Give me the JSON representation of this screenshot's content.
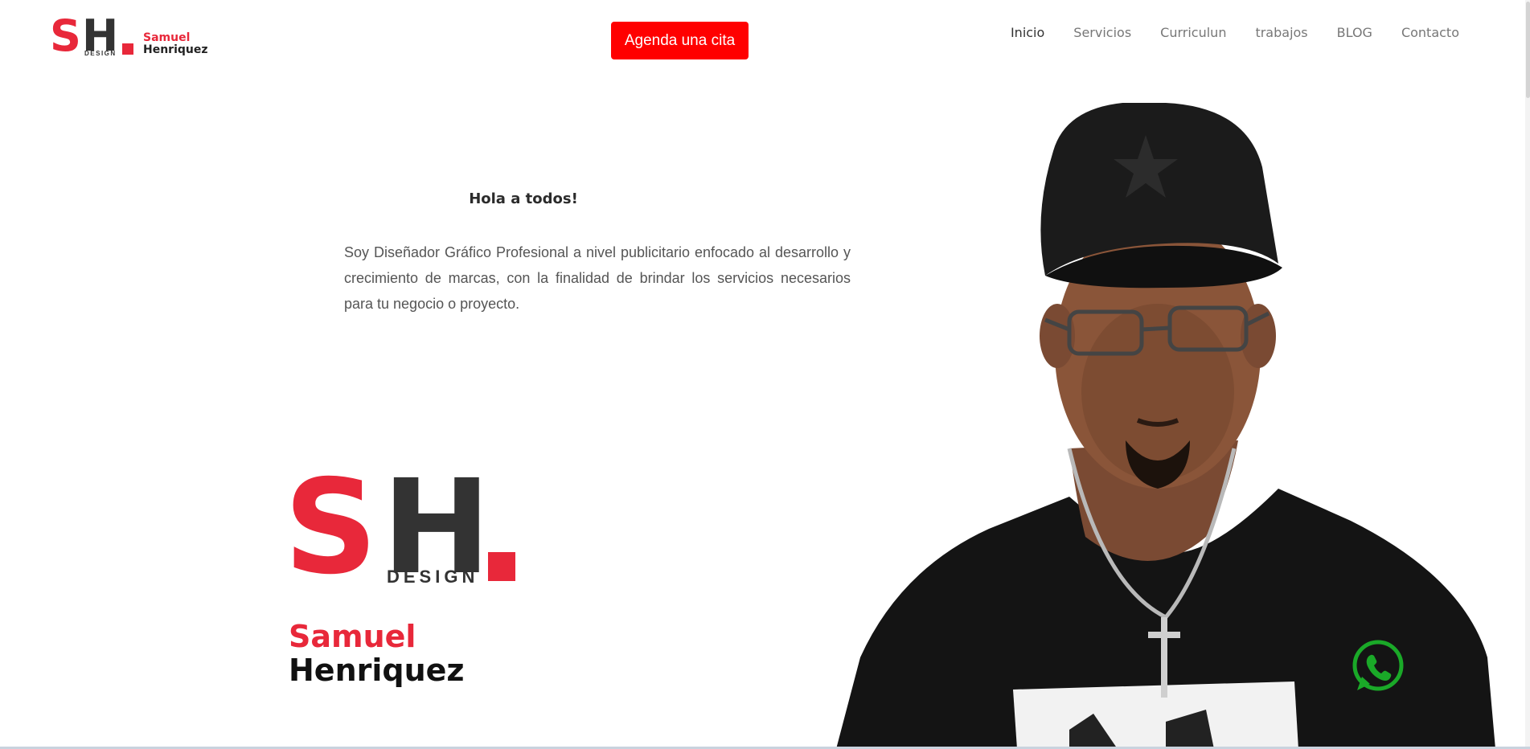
{
  "brand": {
    "mark_s": "S",
    "mark_h": "H",
    "mark_design": "DESIGN",
    "first_name": "Samuel",
    "last_name": "Henriquez",
    "accent_color": "#e8283a",
    "dark_color": "#333333"
  },
  "header": {
    "cta_label": "Agenda una cita",
    "cta_color": "#ff0000",
    "nav": [
      {
        "label": "Inicio",
        "active": true
      },
      {
        "label": "Servicios",
        "active": false
      },
      {
        "label": "Curriculun",
        "active": false
      },
      {
        "label": "trabajos",
        "active": false
      },
      {
        "label": "BLOG",
        "active": false
      },
      {
        "label": "Contacto",
        "active": false
      }
    ]
  },
  "hero": {
    "greeting": "Hola a todos!",
    "body": "Soy Diseñador Gráfico Profesional a nivel publicitario enfocado al desarrollo y crecimiento de marcas, con la finalidad de brindar los servicios necesarios para tu negocio o proyecto."
  },
  "floating": {
    "whatsapp_icon": "whatsapp-icon",
    "whatsapp_color": "#1aa928"
  }
}
